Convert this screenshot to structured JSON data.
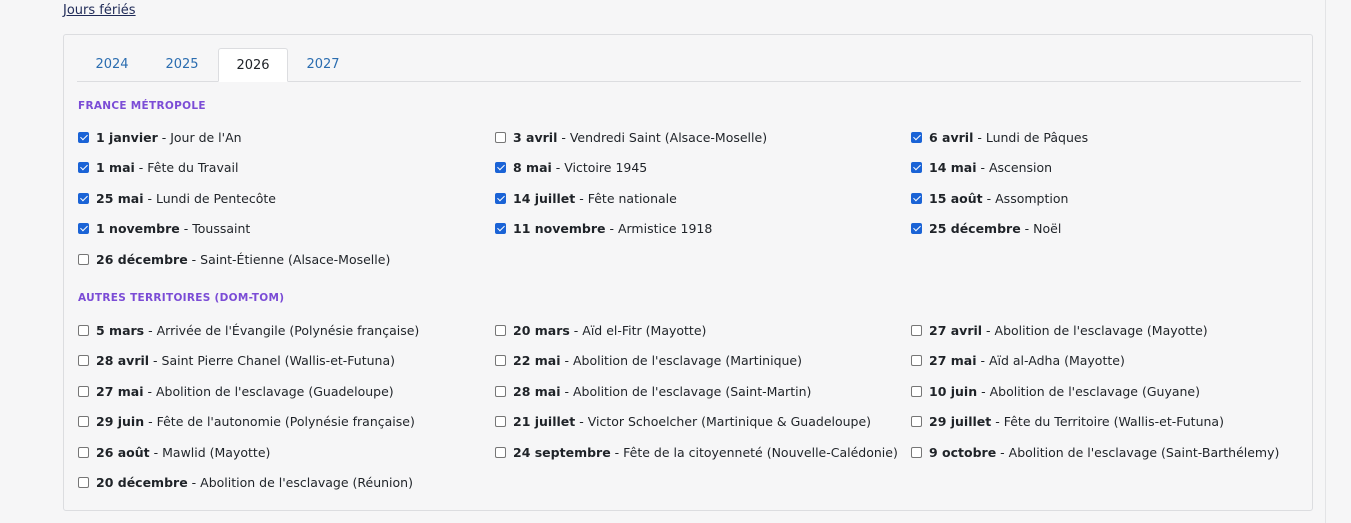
{
  "link": {
    "label": "Jours fériés"
  },
  "tabs": [
    {
      "label": "2024",
      "active": false
    },
    {
      "label": "2025",
      "active": false
    },
    {
      "label": "2026",
      "active": true
    },
    {
      "label": "2027",
      "active": false
    }
  ],
  "separator": " - ",
  "sections": [
    {
      "title": "FRANCE MÉTROPOLE",
      "items": [
        {
          "date": "1 janvier",
          "name": "Jour de l'An",
          "checked": true
        },
        {
          "date": "3 avril",
          "name": "Vendredi Saint (Alsace-Moselle)",
          "checked": false
        },
        {
          "date": "6 avril",
          "name": "Lundi de Pâques",
          "checked": true
        },
        {
          "date": "1 mai",
          "name": "Fête du Travail",
          "checked": true
        },
        {
          "date": "8 mai",
          "name": "Victoire 1945",
          "checked": true
        },
        {
          "date": "14 mai",
          "name": "Ascension",
          "checked": true
        },
        {
          "date": "25 mai",
          "name": "Lundi de Pentecôte",
          "checked": true
        },
        {
          "date": "14 juillet",
          "name": "Fête nationale",
          "checked": true
        },
        {
          "date": "15 août",
          "name": "Assomption",
          "checked": true
        },
        {
          "date": "1 novembre",
          "name": "Toussaint",
          "checked": true
        },
        {
          "date": "11 novembre",
          "name": "Armistice 1918",
          "checked": true
        },
        {
          "date": "25 décembre",
          "name": "Noël",
          "checked": true
        },
        {
          "date": "26 décembre",
          "name": "Saint-Étienne (Alsace-Moselle)",
          "checked": false
        }
      ]
    },
    {
      "title": "AUTRES TERRITOIRES (DOM-TOM)",
      "items": [
        {
          "date": "5 mars",
          "name": "Arrivée de l'Évangile (Polynésie française)",
          "checked": false
        },
        {
          "date": "20 mars",
          "name": "Aïd el-Fitr (Mayotte)",
          "checked": false
        },
        {
          "date": "27 avril",
          "name": "Abolition de l'esclavage (Mayotte)",
          "checked": false
        },
        {
          "date": "28 avril",
          "name": "Saint Pierre Chanel (Wallis-et-Futuna)",
          "checked": false
        },
        {
          "date": "22 mai",
          "name": "Abolition de l'esclavage (Martinique)",
          "checked": false
        },
        {
          "date": "27 mai",
          "name": "Aïd al-Adha (Mayotte)",
          "checked": false
        },
        {
          "date": "27 mai",
          "name": "Abolition de l'esclavage (Guadeloupe)",
          "checked": false
        },
        {
          "date": "28 mai",
          "name": "Abolition de l'esclavage (Saint-Martin)",
          "checked": false
        },
        {
          "date": "10 juin",
          "name": "Abolition de l'esclavage (Guyane)",
          "checked": false
        },
        {
          "date": "29 juin",
          "name": "Fête de l'autonomie (Polynésie française)",
          "checked": false
        },
        {
          "date": "21 juillet",
          "name": "Victor Schoelcher (Martinique & Guadeloupe)",
          "checked": false
        },
        {
          "date": "29 juillet",
          "name": "Fête du Territoire (Wallis-et-Futuna)",
          "checked": false
        },
        {
          "date": "26 août",
          "name": "Mawlid (Mayotte)",
          "checked": false
        },
        {
          "date": "24 septembre",
          "name": "Fête de la citoyenneté (Nouvelle-Calédonie)",
          "checked": false
        },
        {
          "date": "9 octobre",
          "name": "Abolition de l'esclavage (Saint-Barthélemy)",
          "checked": false
        },
        {
          "date": "20 décembre",
          "name": "Abolition de l'esclavage (Réunion)",
          "checked": false
        }
      ]
    }
  ]
}
